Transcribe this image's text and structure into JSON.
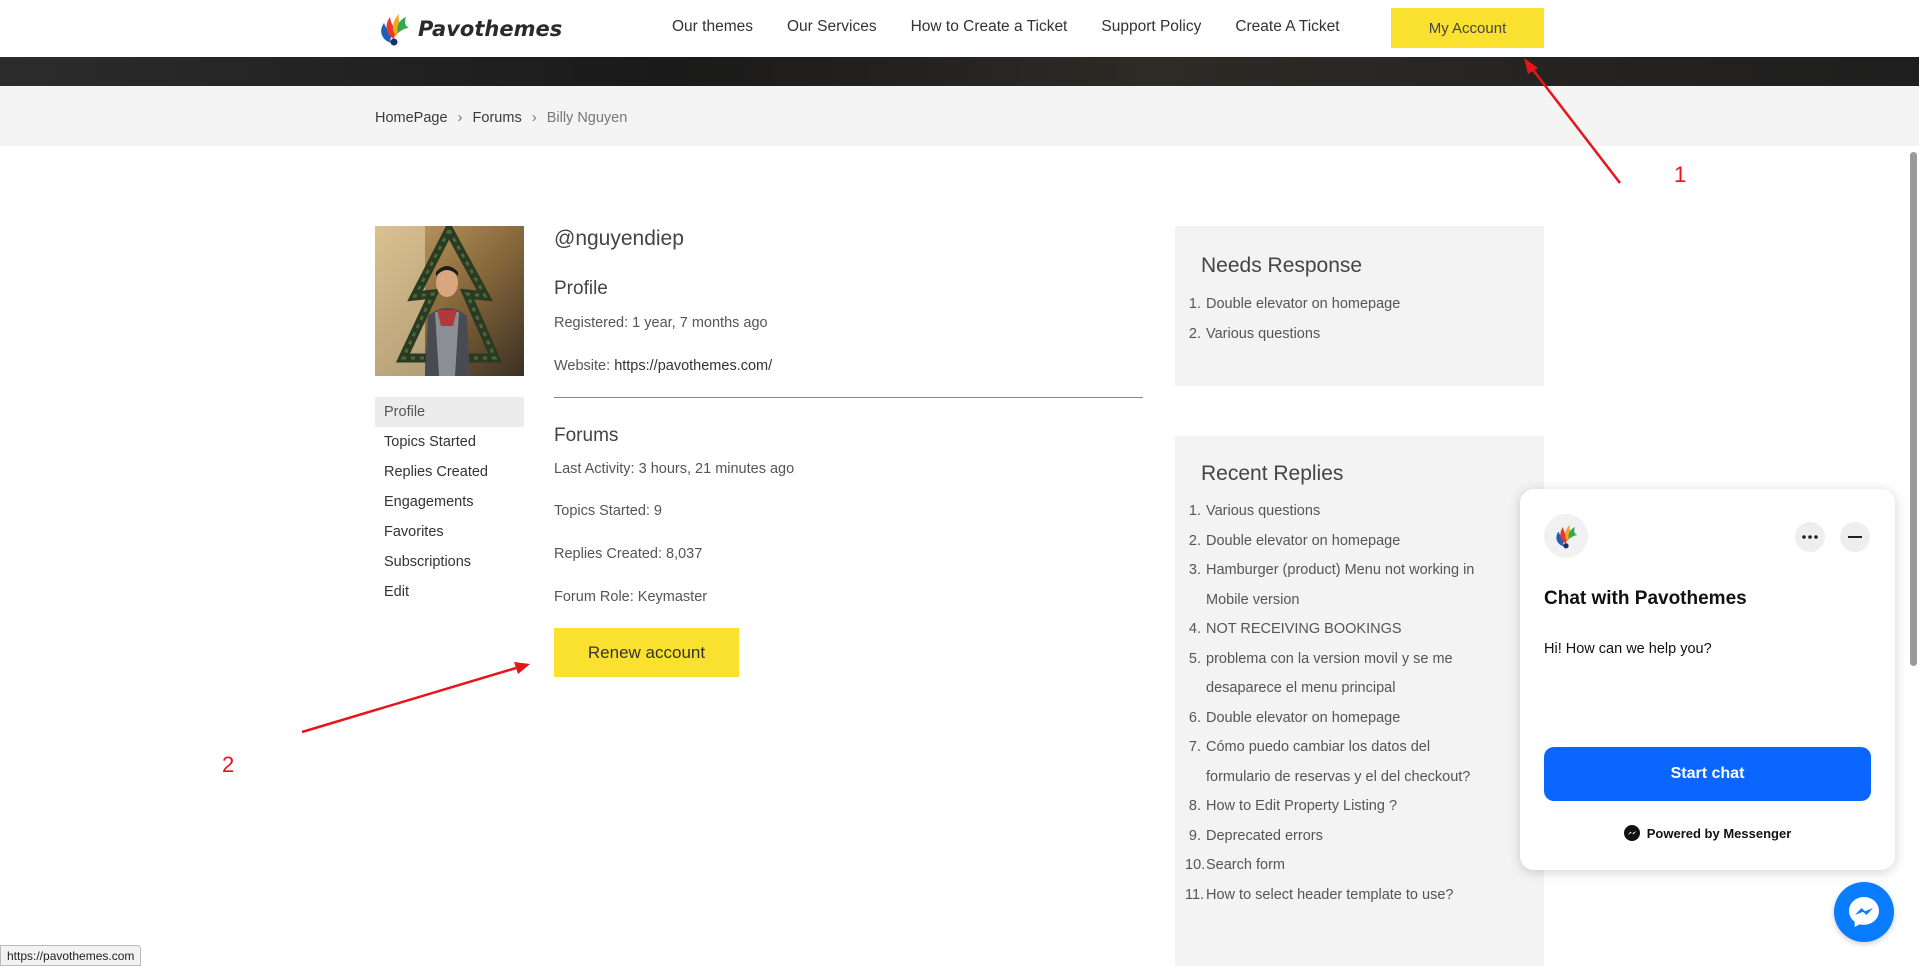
{
  "header": {
    "logo_text": "Pavothemes",
    "nav": [
      "Our themes",
      "Our Services",
      "How to Create a Ticket",
      "Support Policy",
      "Create A Ticket"
    ],
    "account_label": "My Account"
  },
  "breadcrumb": {
    "home": "HomePage",
    "sep": "›",
    "forums": "Forums",
    "current": "Billy Nguyen"
  },
  "sidebar": {
    "items": [
      "Profile",
      "Topics Started",
      "Replies Created",
      "Engagements",
      "Favorites",
      "Subscriptions",
      "Edit"
    ]
  },
  "profile": {
    "handle": "@nguyendiep",
    "profile_title": "Profile",
    "registered": "Registered: 1 year, 7 months ago",
    "website_label": "Website: ",
    "website_url": "https://pavothemes.com/",
    "forums_title": "Forums",
    "last_activity": "Last Activity: 3 hours, 21 minutes ago",
    "topics_started": "Topics Started: 9",
    "replies_created": "Replies Created: 8,037",
    "forum_role": "Forum Role: Keymaster",
    "renew_label": "Renew account"
  },
  "needs_response": {
    "title": "Needs Response",
    "items": [
      {
        "n": "1.",
        "t": "Double elevator on homepage"
      },
      {
        "n": "2.",
        "t": "Various questions"
      }
    ]
  },
  "recent_replies": {
    "title": "Recent Replies",
    "items": [
      {
        "n": "1.",
        "t": "Various questions"
      },
      {
        "n": "2.",
        "t": "Double elevator on homepage"
      },
      {
        "n": "3.",
        "t": "Hamburger (product) Menu not working in Mobile version"
      },
      {
        "n": "4.",
        "t": "NOT RECEIVING BOOKINGS"
      },
      {
        "n": "5.",
        "t": "problema con la version movil y se me desaparece el menu principal"
      },
      {
        "n": "6.",
        "t": "Double elevator on homepage"
      },
      {
        "n": "7.",
        "t": "Cómo puedo cambiar los datos del formulario de reservas y el del checkout?"
      },
      {
        "n": "8.",
        "t": "How to Edit Property Listing ?"
      },
      {
        "n": "9.",
        "t": "Deprecated errors"
      },
      {
        "n": "10.",
        "t": "Search form"
      },
      {
        "n": "11.",
        "t": "How to select header template to use?"
      }
    ]
  },
  "chat": {
    "title": "Chat with Pavothemes",
    "message": "Hi! How can we help you?",
    "start_label": "Start chat",
    "powered": "Powered by Messenger",
    "more_icon": "more-icon",
    "minimize_icon": "minimize-icon"
  },
  "status_url": "https://pavothemes.com",
  "annotations": {
    "one": "1",
    "two": "2"
  },
  "colors": {
    "accent_yellow": "#fae12f",
    "messenger_blue": "#0a66ff",
    "annotation_red": "#e8141c"
  }
}
